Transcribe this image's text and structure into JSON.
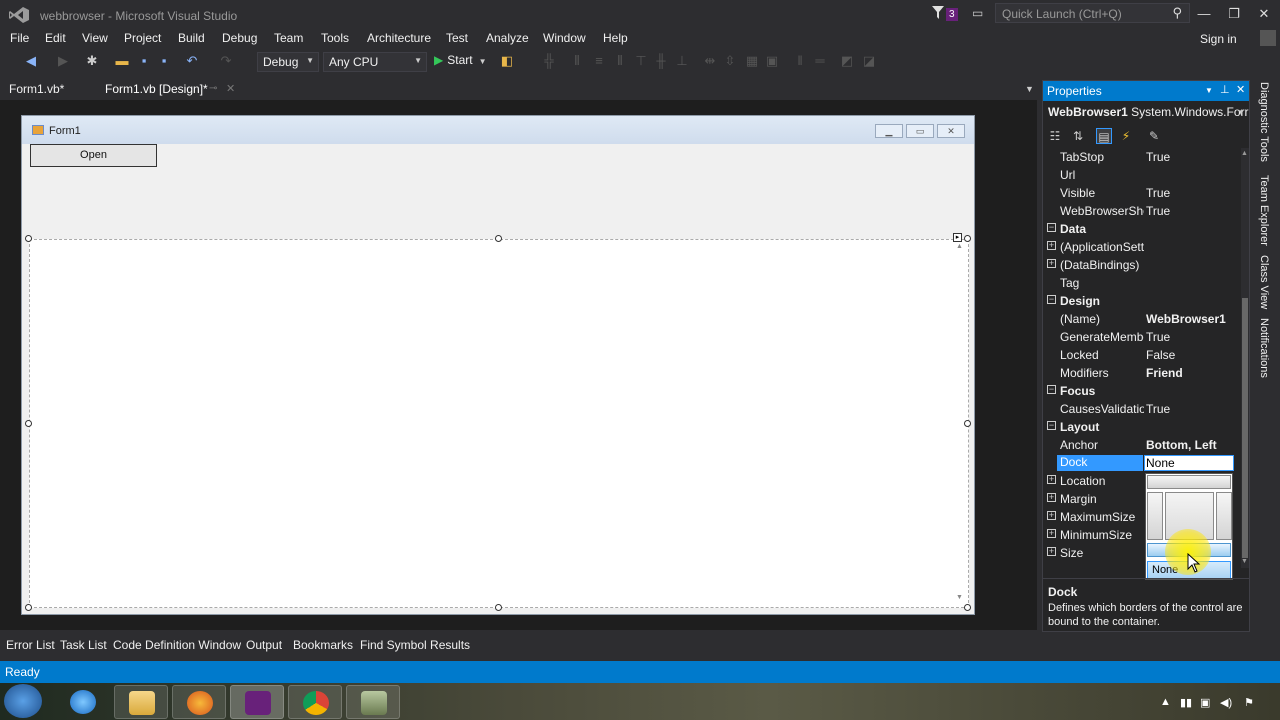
{
  "window": {
    "title": "webbrowser - Microsoft Visual Studio",
    "notification_count": "3",
    "quick_launch_placeholder": "Quick Launch (Ctrl+Q)"
  },
  "menu": {
    "items": [
      "File",
      "Edit",
      "View",
      "Project",
      "Build",
      "Debug",
      "Team",
      "Tools",
      "Architecture",
      "Test",
      "Analyze",
      "Window",
      "Help"
    ],
    "sign_in": "Sign in"
  },
  "toolbar": {
    "config": "Debug",
    "platform": "Any CPU",
    "start_label": "Start"
  },
  "doc_tabs": [
    "Form1.vb*",
    "Form1.vb [Design]*"
  ],
  "designer": {
    "form_title": "Form1",
    "open_button": "Open"
  },
  "properties": {
    "title": "Properties",
    "object_name": "WebBrowser1",
    "object_type": "System.Windows.Forr",
    "rows": [
      {
        "kind": "prop",
        "name": "TabStop",
        "value": "True"
      },
      {
        "kind": "prop",
        "name": "Url",
        "value": ""
      },
      {
        "kind": "prop",
        "name": "Visible",
        "value": "True"
      },
      {
        "kind": "prop",
        "name": "WebBrowserSho",
        "value": "True"
      },
      {
        "kind": "cat",
        "name": "Data",
        "value": ""
      },
      {
        "kind": "expprop",
        "name": "(ApplicationSetti",
        "value": ""
      },
      {
        "kind": "expprop",
        "name": "(DataBindings)",
        "value": ""
      },
      {
        "kind": "prop",
        "name": "Tag",
        "value": ""
      },
      {
        "kind": "cat",
        "name": "Design",
        "value": ""
      },
      {
        "kind": "prop",
        "name": "(Name)",
        "value": "WebBrowser1",
        "bold": true
      },
      {
        "kind": "prop",
        "name": "GenerateMembe",
        "value": "True"
      },
      {
        "kind": "prop",
        "name": "Locked",
        "value": "False"
      },
      {
        "kind": "prop",
        "name": "Modifiers",
        "value": "Friend",
        "bold": true
      },
      {
        "kind": "cat",
        "name": "Focus",
        "value": ""
      },
      {
        "kind": "prop",
        "name": "CausesValidatior",
        "value": "True"
      },
      {
        "kind": "cat",
        "name": "Layout",
        "value": ""
      },
      {
        "kind": "prop",
        "name": "Anchor",
        "value": "Bottom, Left",
        "bold": true
      },
      {
        "kind": "sel",
        "name": "Dock",
        "value": "None"
      },
      {
        "kind": "expprop",
        "name": "Location",
        "value": ""
      },
      {
        "kind": "expprop",
        "name": "Margin",
        "value": ""
      },
      {
        "kind": "expprop",
        "name": "MaximumSize",
        "value": ""
      },
      {
        "kind": "expprop",
        "name": "MinimumSize",
        "value": ""
      },
      {
        "kind": "expprop",
        "name": "Size",
        "value": ""
      }
    ],
    "dock_picker_none": "None",
    "desc_title": "Dock",
    "desc_text": "Defines which borders of the control are bound to the container."
  },
  "bottom_tabs": [
    "Error List",
    "Task List",
    "Code Definition Window",
    "Output",
    "Bookmarks",
    "Find Symbol Results"
  ],
  "status": "Ready",
  "side_tabs": [
    "Diagnostic Tools",
    "Team Explorer",
    "Class View",
    "Notifications"
  ],
  "colors": {
    "accent": "#007acc",
    "selection": "#3399ff",
    "chrome": "#2d2d30"
  }
}
